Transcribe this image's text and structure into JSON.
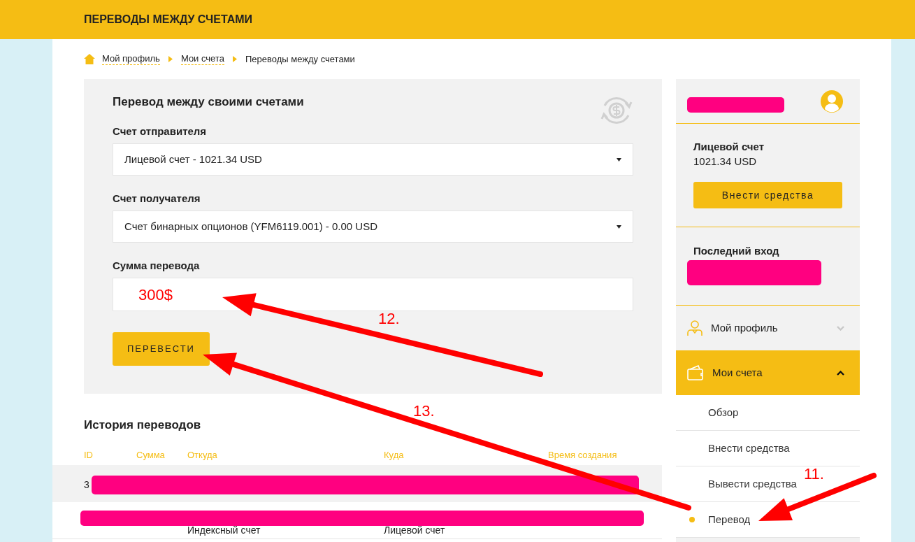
{
  "header": {
    "title": "ПЕРЕВОДЫ МЕЖДУ СЧЕТАМИ"
  },
  "breadcrumb": [
    {
      "label": "Мой профиль",
      "kind": "link"
    },
    {
      "label": "Мои счета",
      "kind": "link"
    },
    {
      "label": "Переводы между счетами",
      "kind": "current"
    }
  ],
  "form": {
    "title": "Перевод между своими счетами",
    "selects": [
      {
        "label": "Счет отправителя",
        "value": "Лицевой счет - 1021.34 USD"
      },
      {
        "label": "Счет получателя",
        "value": "Счет бинарных опционов (YFM6119.001) - 0.00 USD"
      }
    ],
    "amount": {
      "label": "Сумма перевода",
      "value": "300$"
    },
    "submit": "ПЕРЕВЕСТИ"
  },
  "history": {
    "title": "История переводов",
    "columns": [
      "ID",
      "Сумма",
      "Откуда",
      "Куда",
      "Время создания"
    ],
    "rows": [
      {
        "shaded": true,
        "cells": [
          "3",
          "",
          "",
          "",
          ""
        ]
      },
      {
        "shaded": false,
        "cells": [
          "",
          "",
          "Индексный счет",
          "Лицевой счет",
          ""
        ]
      }
    ]
  },
  "sidebar": {
    "account": {
      "title": "Лицевой счет",
      "balance": "1021.34 USD",
      "button": "Внести средства"
    },
    "last_login": {
      "title": "Последний вход"
    },
    "menu": [
      {
        "label": "Мой профиль",
        "expanded": false
      },
      {
        "label": "Мои счета",
        "expanded": true,
        "children": [
          {
            "label": "Обзор",
            "selected": false
          },
          {
            "label": "Внести средства",
            "selected": false
          },
          {
            "label": "Вывести средства",
            "selected": false
          },
          {
            "label": "Перевод",
            "selected": true
          }
        ]
      }
    ]
  },
  "annotations": [
    {
      "text": "12."
    },
    {
      "text": "13."
    },
    {
      "text": "11."
    }
  ]
}
